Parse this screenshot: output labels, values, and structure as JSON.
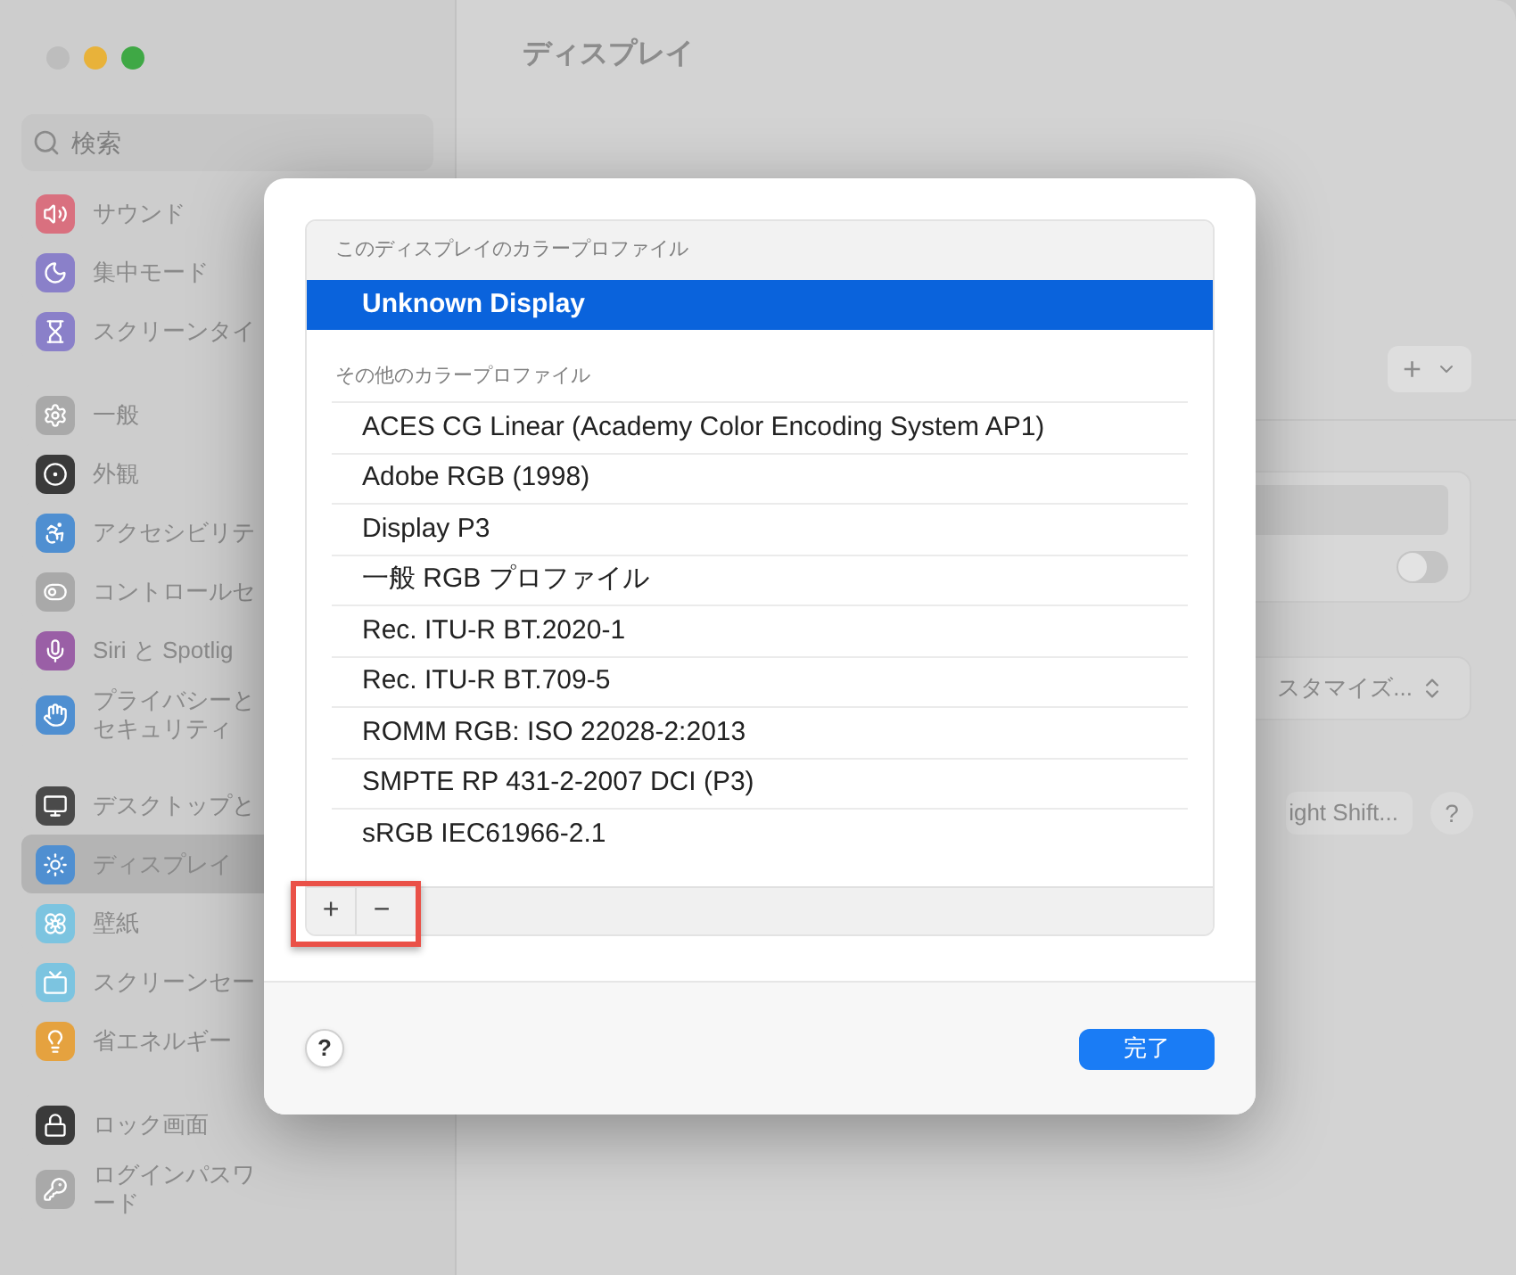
{
  "window": {
    "title": "ディスプレイ"
  },
  "search": {
    "placeholder": "検索"
  },
  "sidebar": {
    "groups": [
      {
        "items": [
          {
            "label": "サウンド",
            "color": "#d9707f",
            "selected": false
          },
          {
            "label": "集中モード",
            "color": "#8a80c9",
            "selected": false
          },
          {
            "label": "スクリーンタイ",
            "color": "#8a80c9",
            "selected": false
          }
        ]
      },
      {
        "items": [
          {
            "label": "一般",
            "color": "#a9a9a9",
            "selected": false
          },
          {
            "label": "外観",
            "color": "#3a3a3a",
            "selected": false
          },
          {
            "label": "アクセシビリテ",
            "color": "#4f8fd1",
            "selected": false
          },
          {
            "label": "コントロールセ",
            "color": "#a9a9a9",
            "selected": false
          },
          {
            "label": "Siri と Spotlig",
            "color": "#9a5fa6",
            "selected": false
          },
          {
            "label": "プライバシーとセキュリティ",
            "color": "#4f8fd1",
            "selected": false
          }
        ]
      },
      {
        "items": [
          {
            "label": "デスクトップと",
            "color": "#4a4a4a",
            "selected": false
          },
          {
            "label": "ディスプレイ",
            "color": "#4f8fd1",
            "selected": true
          },
          {
            "label": "壁紙",
            "color": "#7cc4e0",
            "selected": false
          },
          {
            "label": "スクリーンセー",
            "color": "#7cc4e0",
            "selected": false
          },
          {
            "label": "省エネルギー",
            "color": "#e5a23f",
            "selected": false
          }
        ]
      },
      {
        "items": [
          {
            "label": "ロック画面",
            "color": "#3a3a3a",
            "selected": false
          },
          {
            "label": "ログインパスワード",
            "color": "#a9a9a9",
            "selected": false
          }
        ]
      }
    ]
  },
  "background": {
    "add_label": "+",
    "toggle": {
      "on": false
    },
    "popup_value": "スタマイズ...",
    "night_shift_button": "ight Shift...",
    "help_button": "?"
  },
  "dialog": {
    "this_display_header": "このディスプレイのカラープロファイル",
    "this_display_profiles": [
      {
        "label": "Unknown Display",
        "selected": true
      }
    ],
    "other_header": "その他のカラープロファイル",
    "other_profiles": [
      {
        "label": "ACES CG Linear (Academy Color Encoding System AP1)",
        "selected": false
      },
      {
        "label": "Adobe RGB (1998)",
        "selected": false
      },
      {
        "label": "Display P3",
        "selected": false
      },
      {
        "label": "一般 RGB プロファイル",
        "selected": false
      },
      {
        "label": "Rec. ITU-R BT.2020-1",
        "selected": false
      },
      {
        "label": "Rec. ITU-R BT.709-5",
        "selected": false
      },
      {
        "label": "ROMM RGB: ISO 22028-2:2013",
        "selected": false
      },
      {
        "label": "SMPTE RP 431-2-2007 DCI (P3)",
        "selected": false
      },
      {
        "label": "sRGB IEC61966-2.1",
        "selected": false
      }
    ],
    "add_button": "+",
    "remove_button": "−",
    "help_button": "?",
    "done_button": "完了"
  }
}
